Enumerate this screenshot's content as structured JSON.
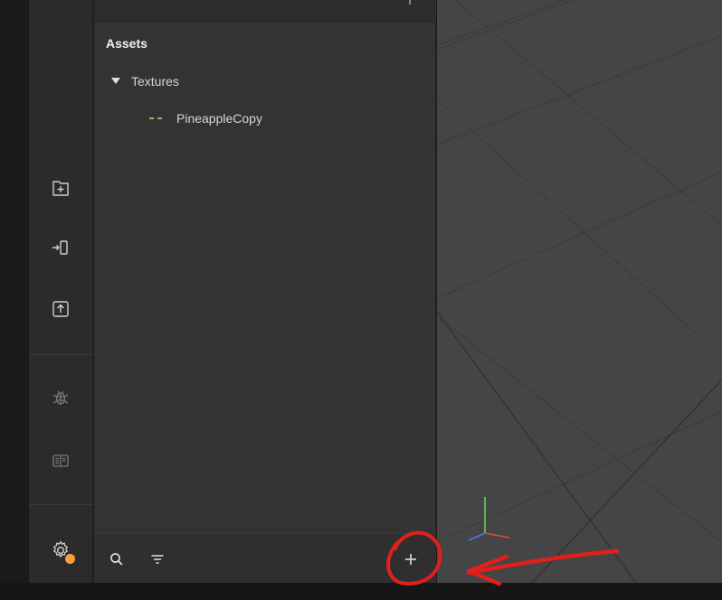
{
  "explorer": {
    "section_title": "Assets",
    "folder": {
      "label": "Textures",
      "expanded": true
    },
    "file": {
      "label": "PineappleCopy"
    }
  },
  "activity_bar": {
    "icons": [
      "new-folder-icon",
      "import-icon",
      "upload-icon",
      "bug-icon",
      "book-icon",
      "settings-icon"
    ],
    "badge_color": "#f5a03a"
  },
  "bottom_bar": {
    "icons": [
      "search-icon",
      "filter-icon",
      "plus-icon"
    ]
  },
  "colors": {
    "panel": "#333333",
    "viewport": "#454545",
    "annotation": "#e0201b",
    "file_icon": "#a8b43a"
  }
}
